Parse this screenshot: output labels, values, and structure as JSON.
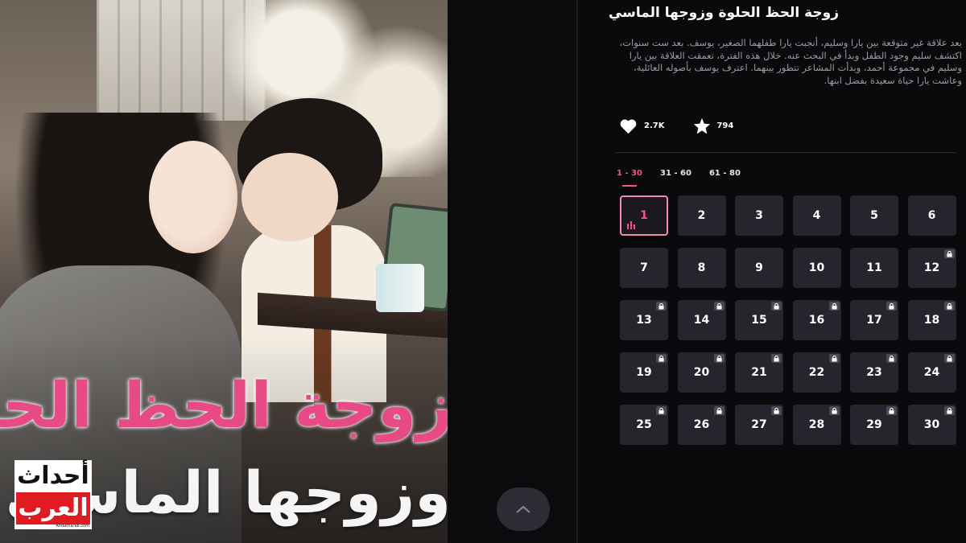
{
  "poster": {
    "title_line1": "زوجة الحظ الحلوة",
    "title_line2": "وزوجها الماسي"
  },
  "logo": {
    "line1": "أحداث",
    "line2": "العرب",
    "site": "Ahdatharab.com"
  },
  "show": {
    "title": "زوجة الحظ الحلوة وزوجها الماسي",
    "description": "بعد علاقة غير متوقعة بين يارا وسليم، أنجبت يارا طفلهما الصغير، يوسف. بعد ست سنوات، اكتشف سليم وجود الطفل وبدأ في البحث عنه. خلال هذه الفترة، تعمقت العلاقة بين يارا وسليم في مجموعة أحمد، وبدأت المشاعر تتطور بينهما. اعترف يوسف بأصوله العائلية، وعاشت يارا حياة سعيدة بفضل ابنها.",
    "likes": "2.7K",
    "favorites": "794"
  },
  "tabs": [
    {
      "label": "1 - 30",
      "active": true
    },
    {
      "label": "31 - 60",
      "active": false
    },
    {
      "label": "61 - 80",
      "active": false
    }
  ],
  "episodes": [
    {
      "n": "1",
      "locked": false,
      "current": true
    },
    {
      "n": "2",
      "locked": false
    },
    {
      "n": "3",
      "locked": false
    },
    {
      "n": "4",
      "locked": false
    },
    {
      "n": "5",
      "locked": false
    },
    {
      "n": "6",
      "locked": false
    },
    {
      "n": "7",
      "locked": false
    },
    {
      "n": "8",
      "locked": false
    },
    {
      "n": "9",
      "locked": false
    },
    {
      "n": "10",
      "locked": false
    },
    {
      "n": "11",
      "locked": false
    },
    {
      "n": "12",
      "locked": true
    },
    {
      "n": "13",
      "locked": true
    },
    {
      "n": "14",
      "locked": true
    },
    {
      "n": "15",
      "locked": true
    },
    {
      "n": "16",
      "locked": true
    },
    {
      "n": "17",
      "locked": true
    },
    {
      "n": "18",
      "locked": true
    },
    {
      "n": "19",
      "locked": true
    },
    {
      "n": "20",
      "locked": true
    },
    {
      "n": "21",
      "locked": true
    },
    {
      "n": "22",
      "locked": true
    },
    {
      "n": "23",
      "locked": true
    },
    {
      "n": "24",
      "locked": true
    },
    {
      "n": "25",
      "locked": true
    },
    {
      "n": "26",
      "locked": true
    },
    {
      "n": "27",
      "locked": true
    },
    {
      "n": "28",
      "locked": true
    },
    {
      "n": "29",
      "locked": true
    },
    {
      "n": "30",
      "locked": true
    }
  ],
  "colors": {
    "accent": "#ff4f8b",
    "tile": "#25252e",
    "background": "#0a0a0c"
  },
  "icons": {
    "like": "heart-icon",
    "favorite": "star-icon",
    "lock": "lock-icon",
    "scroll_up": "chevron-up-icon",
    "playing": "equalizer-icon"
  }
}
